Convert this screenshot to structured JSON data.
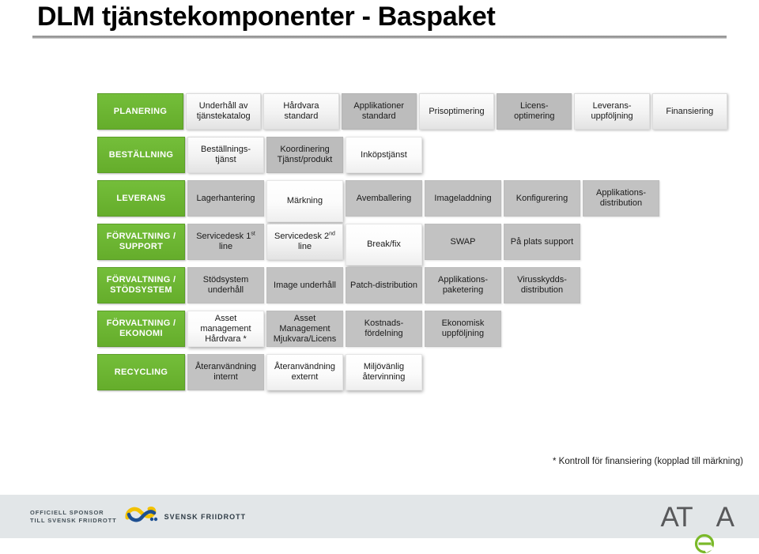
{
  "slide": {
    "title": "DLM tjänstekomponenter - Baspaket",
    "footnote": "* Kontroll för finansiering (kopplad till märkning)"
  },
  "colors": {
    "green": "#6ab42e",
    "gray": "#c2c2c2",
    "dark_gray": "#bcbcbc",
    "light": "#f2f2f2",
    "footer_bg": "#e2e6e8",
    "atea_gray": "#58595b",
    "atea_green": "#7ab929",
    "sponsor_blue": "#1d4f91",
    "sponsor_yellow": "#f2c100"
  },
  "matrix": {
    "rows": [
      {
        "category": "PLANERING",
        "cells": [
          {
            "label": "Underhåll av tjänstekatalog",
            "style": "light",
            "height": "norm"
          },
          {
            "label": "Hårdvara standard",
            "style": "light",
            "height": "norm"
          },
          {
            "label": "Applikationer standard",
            "style": "dark",
            "height": "norm"
          },
          {
            "label": "Prisoptimering",
            "style": "light",
            "height": "norm"
          },
          {
            "label": "Licens- optimering",
            "style": "dark",
            "height": "norm"
          },
          {
            "label": "Leverans- uppföljning",
            "style": "light",
            "height": "norm"
          },
          {
            "label": "Finansiering",
            "style": "light",
            "height": "norm"
          }
        ]
      },
      {
        "category": "BESTÄLLNING",
        "cells": [
          {
            "label": "Beställnings- tjänst",
            "style": "light",
            "height": "norm"
          },
          {
            "label": "Koordinering Tjänst/produkt",
            "style": "dark",
            "height": "norm"
          },
          {
            "label": "Inköpstjänst",
            "style": "white",
            "height": "norm"
          }
        ]
      },
      {
        "category": "LEVERANS",
        "cells": [
          {
            "label": "Lagerhantering",
            "style": "gray",
            "height": "norm"
          },
          {
            "label": "Märkning",
            "style": "white",
            "height": "tall"
          },
          {
            "label": "Avemballering",
            "style": "gray",
            "height": "norm"
          },
          {
            "label": "Imageladdning",
            "style": "gray",
            "height": "norm"
          },
          {
            "label": "Konfigurering",
            "style": "gray",
            "height": "norm"
          },
          {
            "label": "Applikations- distribution",
            "style": "gray",
            "height": "norm"
          }
        ]
      },
      {
        "category": "FÖRVALTNING / SUPPORT",
        "cells": [
          {
            "label": "Servicedesk 1st line",
            "style": "gray",
            "height": "norm",
            "sup": "st"
          },
          {
            "label": "Servicedesk 2nd line",
            "style": "light",
            "height": "norm",
            "sup": "nd"
          },
          {
            "label": "Break/fix",
            "style": "white",
            "height": "tall"
          },
          {
            "label": "SWAP",
            "style": "gray",
            "height": "norm"
          },
          {
            "label": "På plats support",
            "style": "gray",
            "height": "norm"
          }
        ]
      },
      {
        "category": "FÖRVALTNING / STÖDSYSTEM",
        "cells": [
          {
            "label": "Stödsystem underhåll",
            "style": "gray",
            "height": "norm"
          },
          {
            "label": "Image underhåll",
            "style": "gray",
            "height": "norm"
          },
          {
            "label": "Patch-distribution",
            "style": "gray",
            "height": "norm"
          },
          {
            "label": "Applikations- paketering",
            "style": "gray",
            "height": "norm"
          },
          {
            "label": "Virusskydds- distribution",
            "style": "gray",
            "height": "norm"
          }
        ]
      },
      {
        "category": "FÖRVALTNING / EKONOMI",
        "cells": [
          {
            "label": "Asset management Hårdvara *",
            "style": "white",
            "height": "norm"
          },
          {
            "label": "Asset Management Mjukvara/Licens",
            "style": "gray",
            "height": "norm"
          },
          {
            "label": "Kostnads- fördelning",
            "style": "gray",
            "height": "norm"
          },
          {
            "label": "Ekonomisk uppföljning",
            "style": "gray",
            "height": "norm"
          }
        ]
      },
      {
        "category": "RECYCLING",
        "cells": [
          {
            "label": "Återanvändning internt",
            "style": "gray",
            "height": "norm"
          },
          {
            "label": "Återanvändning externt",
            "style": "white",
            "height": "norm"
          },
          {
            "label": "Miljövänlig återvinning",
            "style": "white",
            "height": "norm"
          }
        ]
      }
    ]
  },
  "footer": {
    "sponsor_line1": "OFFICIELL SPONSOR",
    "sponsor_line2": "TILL SVENSK FRIIDROTT",
    "sponsor_name": "SVENSK FRIIDROTT",
    "atea_wordmark_before": "AT",
    "atea_wordmark_e": "e",
    "atea_wordmark_after": "A"
  }
}
